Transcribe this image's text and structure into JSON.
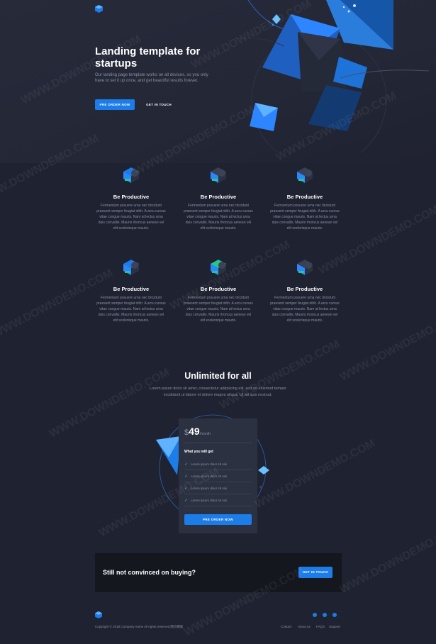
{
  "brand": {
    "accent": "#1c7ce8",
    "bg": "#1f2230"
  },
  "hero": {
    "title": "Landing template for startups",
    "description": "Our landing page template works on all devices, so you only have to set it up once, and get beautiful results forever.",
    "primary_button": "PRE ORDER NOW",
    "secondary_button": "GET IN TOUCH"
  },
  "features": [
    {
      "title": "Be Productive",
      "text": "Fermentum posuere urna nec tincidunt praesent semper feugiat nibh. A arcu cursus vitae congue mauris. Nam at lectus urna duis convallis. Mauris rhoncus aenean vel elit scelerisque mauris.",
      "icon": "cube-blue-icon"
    },
    {
      "title": "Be Productive",
      "text": "Fermentum posuere urna nec tincidunt praesent semper feugiat nibh. A arcu cursus vitae congue mauris. Nam at lectus urna duis convallis. Mauris rhoncus aenean vel elit scelerisque mauris.",
      "icon": "cube-dark-icon"
    },
    {
      "title": "Be Productive",
      "text": "Fermentum posuere urna nec tincidunt praesent semper feugiat nibh. A arcu cursus vitae congue mauris. Nam at lectus urna duis convallis. Mauris rhoncus aenean vel elit scelerisque mauris.",
      "icon": "cube-dark-icon"
    },
    {
      "title": "Be Productive",
      "text": "Fermentum posuere urna nec tincidunt praesent semper feugiat nibh. A arcu cursus vitae congue mauris. Nam at lectus urna duis convallis. Mauris rhoncus aenean vel elit scelerisque mauris.",
      "icon": "cube-blue-icon"
    },
    {
      "title": "Be Productive",
      "text": "Fermentum posuere urna nec tincidunt praesent semper feugiat nibh. A arcu cursus vitae congue mauris. Nam at lectus urna duis convallis. Mauris rhoncus aenean vel elit scelerisque mauris.",
      "icon": "cube-green-icon"
    },
    {
      "title": "Be Productive",
      "text": "Fermentum posuere urna nec tincidunt praesent semper feugiat nibh. A arcu cursus vitae congue mauris. Nam at lectus urna duis convallis. Mauris rhoncus aenean vel elit scelerisque mauris.",
      "icon": "cube-dark-icon"
    }
  ],
  "pricing": {
    "title": "Unlimited for all",
    "description": "Lorem ipsum dolor sit amet, consectetur adipiscing elit, sed do eiusmod tempor incididunt ut labore et dolore magna aliqua. Ut ad quis nostrud.",
    "currency": "$",
    "amount": "49",
    "period": "/month",
    "subtitle": "What you will get",
    "items": [
      "Lorem ipsum dolor sit nisi",
      "Lorem ipsum dolor sit nisi",
      "Lorem ipsum dolor sit nisi",
      "Lorem ipsum dolor sit nisi"
    ],
    "button": "PRE ORDER NOW"
  },
  "cta": {
    "title": "Still not convinced on buying?",
    "button": "GET IN TOUCH"
  },
  "footer": {
    "copyright": "Copyright © 2019 Company name All rights reserved.网页模板",
    "links": [
      "Contact",
      "About us",
      "FAQ's",
      "Support"
    ],
    "social": [
      "facebook-icon",
      "twitter-icon",
      "google-icon"
    ]
  },
  "watermark": "WWW.DOWNDEMO.COM"
}
